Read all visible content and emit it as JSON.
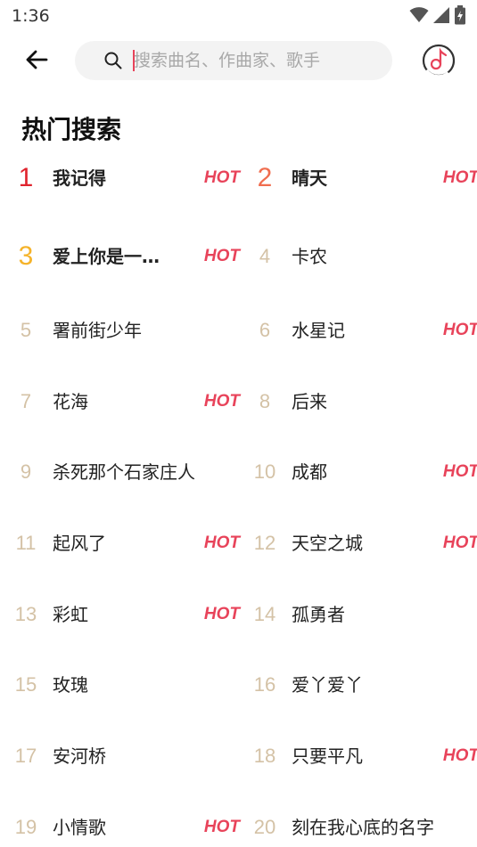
{
  "status_bar": {
    "time": "1:36"
  },
  "search": {
    "placeholder": "搜索曲名、作曲家、歌手"
  },
  "section_title": "热门搜索",
  "hot_label": "HOT",
  "colors": {
    "accent": "#e8435a",
    "rank1": "#e0242e",
    "rank2": "#f06d4f",
    "rank3": "#f5b32a",
    "rank_other": "#d4c2a6"
  },
  "items": [
    {
      "rank": "1",
      "name": "我记得",
      "hot": true
    },
    {
      "rank": "2",
      "name": "晴天",
      "hot": true
    },
    {
      "rank": "3",
      "name": "爱上你是一…",
      "hot": true
    },
    {
      "rank": "4",
      "name": "卡农",
      "hot": false
    },
    {
      "rank": "5",
      "name": "署前街少年",
      "hot": false
    },
    {
      "rank": "6",
      "name": "水星记",
      "hot": true
    },
    {
      "rank": "7",
      "name": "花海",
      "hot": true
    },
    {
      "rank": "8",
      "name": "后来",
      "hot": false
    },
    {
      "rank": "9",
      "name": "杀死那个石家庄人",
      "hot": false
    },
    {
      "rank": "10",
      "name": "成都",
      "hot": true
    },
    {
      "rank": "11",
      "name": "起风了",
      "hot": true
    },
    {
      "rank": "12",
      "name": "天空之城",
      "hot": true
    },
    {
      "rank": "13",
      "name": "彩虹",
      "hot": true
    },
    {
      "rank": "14",
      "name": "孤勇者",
      "hot": false
    },
    {
      "rank": "15",
      "name": "玫瑰",
      "hot": false
    },
    {
      "rank": "16",
      "name": "爱丫爱丫",
      "hot": false
    },
    {
      "rank": "17",
      "name": "安河桥",
      "hot": false
    },
    {
      "rank": "18",
      "name": "只要平凡",
      "hot": true
    },
    {
      "rank": "19",
      "name": "小情歌",
      "hot": true
    },
    {
      "rank": "20",
      "name": "刻在我心底的名字",
      "hot": false
    }
  ]
}
